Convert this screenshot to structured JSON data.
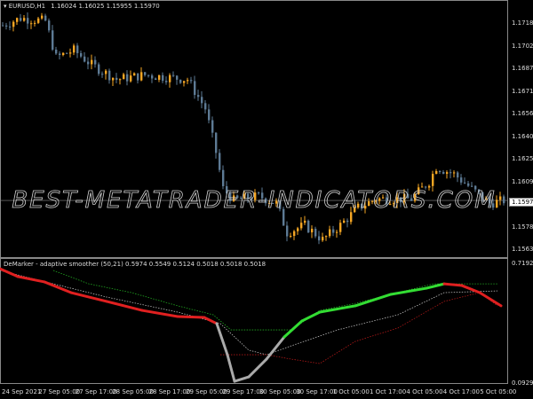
{
  "header": {
    "symbol": "EURUSD,H1",
    "ohlc": "1.16024 1.16025 1.15955 1.15970"
  },
  "indicator_header": "DeMarker - adaptive smoother (50,21) 0.5974 0.5549 0.5124 0.5018 0.5018 0.5018",
  "watermark": "BEST-METATRADER-INDICATORS.COM",
  "colors": {
    "bull": "#f5a623",
    "bear": "#5d7a94",
    "up": "#33dd33",
    "down": "#e02020",
    "neutral": "#aaaaaa"
  },
  "chart_data": [
    {
      "type": "candlestick",
      "title": "EURUSD,H1",
      "y_ticks": [
        "1.17180",
        "1.17025",
        "1.16870",
        "1.16715",
        "1.16560",
        "1.16405",
        "1.16250",
        "1.16095",
        "1.15940",
        "1.15785",
        "1.15630"
      ],
      "ylim": [
        1.1558,
        1.1731
      ],
      "current_price": "1.15970",
      "bars": 142,
      "close_anchors": [
        [
          0,
          1.1717
        ],
        [
          5,
          1.1722
        ],
        [
          12,
          1.172
        ],
        [
          15,
          1.1695
        ],
        [
          20,
          1.17
        ],
        [
          25,
          1.169
        ],
        [
          32,
          1.168
        ],
        [
          40,
          1.1683
        ],
        [
          52,
          1.168
        ],
        [
          57,
          1.166
        ],
        [
          60,
          1.163
        ],
        [
          62,
          1.1605
        ],
        [
          65,
          1.1597
        ],
        [
          72,
          1.16
        ],
        [
          77,
          1.1595
        ],
        [
          80,
          1.1575
        ],
        [
          85,
          1.158
        ],
        [
          90,
          1.157
        ],
        [
          95,
          1.158
        ],
        [
          100,
          1.1592
        ],
        [
          105,
          1.1598
        ],
        [
          115,
          1.1598
        ],
        [
          120,
          1.161
        ],
        [
          122,
          1.162
        ],
        [
          127,
          1.1615
        ],
        [
          132,
          1.1605
        ],
        [
          137,
          1.1595
        ],
        [
          141,
          1.1597
        ]
      ]
    },
    {
      "type": "line",
      "title": "DeMarker - adaptive smoother (50,21)",
      "ylim": [
        0.0929,
        0.7192
      ],
      "y_ticks": [
        "0.7192",
        "0.0929"
      ],
      "x_ticks": [
        "24 Sep 2021",
        "27 Sep 05:00",
        "27 Sep 17:00",
        "28 Sep 05:00",
        "28 Sep 17:00",
        "29 Sep 05:00",
        "29 Sep 17:00",
        "30 Sep 05:00",
        "30 Sep 17:00",
        "1 Oct 05:00",
        "1 Oct 17:00",
        "4 Oct 05:00",
        "4 Oct 17:00",
        "5 Oct 05:00"
      ],
      "series": [
        {
          "name": "smoother",
          "points": [
            [
              0,
              0.691
            ],
            [
              5,
              0.65
            ],
            [
              12.5,
              0.622
            ],
            [
              20,
              0.566
            ],
            [
              30,
              0.52
            ],
            [
              40,
              0.473
            ],
            [
              50,
              0.441
            ],
            [
              57.5,
              0.436
            ],
            [
              61,
              0.404
            ],
            [
              64,
              0.241
            ],
            [
              66,
              0.102
            ],
            [
              70,
              0.125
            ],
            [
              75,
              0.218
            ],
            [
              80,
              0.334
            ],
            [
              85,
              0.418
            ],
            [
              90,
              0.464
            ],
            [
              100,
              0.497
            ],
            [
              110,
              0.557
            ],
            [
              120,
              0.589
            ],
            [
              125,
              0.612
            ],
            [
              130,
              0.603
            ],
            [
              135,
              0.566
            ],
            [
              141,
              0.497
            ]
          ]
        },
        {
          "name": "upper level",
          "points": [
            [
              15,
              0.682
            ],
            [
              25,
              0.612
            ],
            [
              37,
              0.566
            ],
            [
              50,
              0.497
            ],
            [
              60,
              0.45
            ],
            [
              65,
              0.371
            ],
            [
              75,
              0.371
            ],
            [
              82,
              0.371
            ],
            [
              90,
              0.473
            ],
            [
              100,
              0.51
            ],
            [
              112,
              0.566
            ],
            [
              122,
              0.612
            ],
            [
              140,
              0.612
            ]
          ]
        },
        {
          "name": "middle level",
          "points": [
            [
              0,
              0.682
            ],
            [
              15,
              0.612
            ],
            [
              30,
              0.543
            ],
            [
              50,
              0.464
            ],
            [
              62,
              0.404
            ],
            [
              70,
              0.265
            ],
            [
              75,
              0.241
            ],
            [
              82,
              0.288
            ],
            [
              95,
              0.371
            ],
            [
              112,
              0.45
            ],
            [
              125,
              0.566
            ],
            [
              140,
              0.575
            ]
          ]
        },
        {
          "name": "lower level",
          "points": [
            [
              62,
              0.241
            ],
            [
              75,
              0.241
            ],
            [
              82,
              0.218
            ],
            [
              90,
              0.195
            ],
            [
              100,
              0.311
            ],
            [
              112,
              0.381
            ],
            [
              125,
              0.52
            ],
            [
              135,
              0.566
            ],
            [
              140,
              0.497
            ]
          ]
        }
      ]
    }
  ]
}
